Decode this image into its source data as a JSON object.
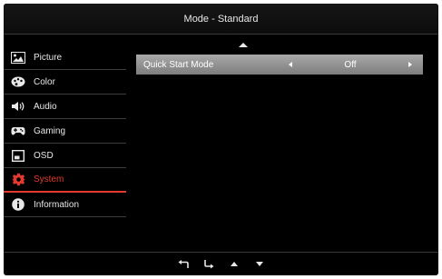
{
  "header": {
    "title": "Mode - Standard"
  },
  "sidebar": {
    "items": [
      {
        "label": "Picture",
        "icon": "picture-icon"
      },
      {
        "label": "Color",
        "icon": "palette-icon"
      },
      {
        "label": "Audio",
        "icon": "speaker-icon"
      },
      {
        "label": "Gaming",
        "icon": "gamepad-icon"
      },
      {
        "label": "OSD",
        "icon": "osd-icon"
      },
      {
        "label": "System",
        "icon": "gear-icon",
        "active": true
      },
      {
        "label": "Information",
        "icon": "info-icon"
      }
    ]
  },
  "content": {
    "setting": {
      "label": "Quick Start Mode",
      "value": "Off"
    }
  },
  "footer": {
    "buttons": [
      "back-icon",
      "enter-icon",
      "up-icon",
      "down-icon"
    ]
  },
  "colors": {
    "accent": "#e23a2e",
    "background": "#000000",
    "selected_row": "#9a9a9a"
  }
}
